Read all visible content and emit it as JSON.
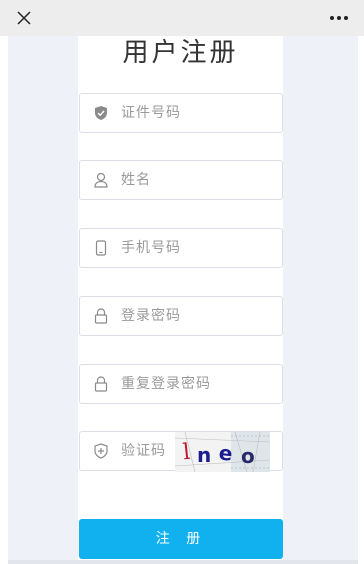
{
  "topbar": {
    "close_icon": "close-icon",
    "more_icon": "more-dots-icon"
  },
  "page": {
    "title": "用户注册"
  },
  "form": {
    "id_number": {
      "placeholder": "证件号码",
      "icon": "shield-check-icon"
    },
    "name": {
      "placeholder": "姓名",
      "icon": "user-icon"
    },
    "phone": {
      "placeholder": "手机号码",
      "icon": "mobile-phone-icon"
    },
    "password": {
      "placeholder": "登录密码",
      "icon": "lock-icon"
    },
    "password_confirm": {
      "placeholder": "重复登录密码",
      "icon": "lock-icon"
    },
    "captcha": {
      "placeholder": "验证码",
      "icon": "shield-plus-icon",
      "image_text": "lneo"
    },
    "submit_label": "注 册"
  },
  "colors": {
    "accent": "#11b1ef",
    "panel": "#ffffff",
    "background": "#eef1f7"
  }
}
